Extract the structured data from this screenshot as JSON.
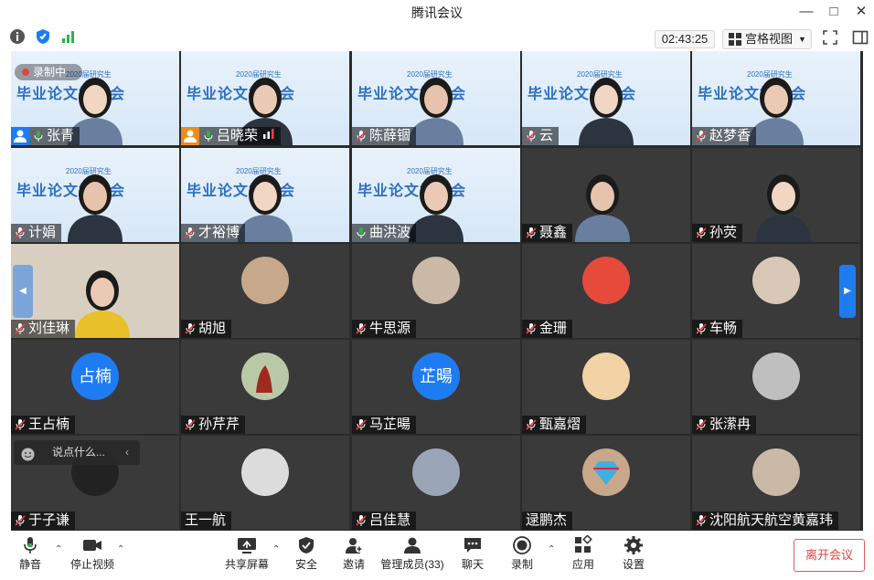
{
  "window": {
    "title": "腾讯会议"
  },
  "top": {
    "timer": "02:43:25",
    "view_label": "宫格视图"
  },
  "recording": {
    "label": "录制中"
  },
  "banner": {
    "title": "毕业论文答辩会",
    "subtitle": "2020届研究生"
  },
  "participants": [
    {
      "name": "张青",
      "type": "banner",
      "audio": "on",
      "host": true
    },
    {
      "name": "吕晓荣",
      "type": "banner",
      "audio": "on",
      "host": true
    },
    {
      "name": "陈薛锢",
      "type": "banner",
      "audio": "muted"
    },
    {
      "name": "云",
      "type": "banner",
      "audio": "muted"
    },
    {
      "name": "赵梦香",
      "type": "banner",
      "audio": "muted"
    },
    {
      "name": "计娟",
      "type": "banner",
      "audio": "muted"
    },
    {
      "name": "才裕博",
      "type": "banner",
      "audio": "muted"
    },
    {
      "name": "曲洪波",
      "type": "banner",
      "audio": "on"
    },
    {
      "name": "聂鑫",
      "type": "video",
      "audio": "muted"
    },
    {
      "name": "孙荧",
      "type": "video",
      "audio": "muted"
    },
    {
      "name": "刘佳琳",
      "type": "video",
      "audio": "muted"
    },
    {
      "name": "胡旭",
      "type": "avatar",
      "audio": "muted"
    },
    {
      "name": "牛思源",
      "type": "avatar",
      "audio": "muted"
    },
    {
      "name": "金珊",
      "type": "avatar",
      "audio": "muted"
    },
    {
      "name": "车畅",
      "type": "avatar",
      "audio": "muted"
    },
    {
      "name": "王占楠",
      "type": "text",
      "avatar_text": "占楠",
      "audio": "muted"
    },
    {
      "name": "孙芹芹",
      "type": "avatar",
      "audio": "muted"
    },
    {
      "name": "马芷暘",
      "type": "text",
      "avatar_text": "芷暘",
      "audio": "muted"
    },
    {
      "name": "甄嘉熠",
      "type": "avatar",
      "audio": "muted"
    },
    {
      "name": "张潆冉",
      "type": "avatar",
      "audio": "muted"
    },
    {
      "name": "于子谦",
      "type": "avatar",
      "audio": "muted"
    },
    {
      "name": "王一航",
      "type": "avatar",
      "audio": "none"
    },
    {
      "name": "吕佳慧",
      "type": "avatar",
      "audio": "muted"
    },
    {
      "name": "逯鹏杰",
      "type": "avatar",
      "audio": "none"
    },
    {
      "name": "沈阳航天航空黄嘉玮",
      "type": "avatar",
      "audio": "muted"
    }
  ],
  "chat": {
    "placeholder": "说点什么..."
  },
  "bottom": {
    "mute": "静音",
    "stop_video": "停止视频",
    "share": "共享屏幕",
    "security": "安全",
    "invite": "邀请",
    "members": "管理成员(33)",
    "chat": "聊天",
    "record": "录制",
    "apps": "应用",
    "settings": "设置",
    "leave": "离开会议"
  },
  "colors": {
    "accent": "#1e7cf2",
    "leave": "#e04545",
    "grid_bg": "#2b2b2b"
  }
}
